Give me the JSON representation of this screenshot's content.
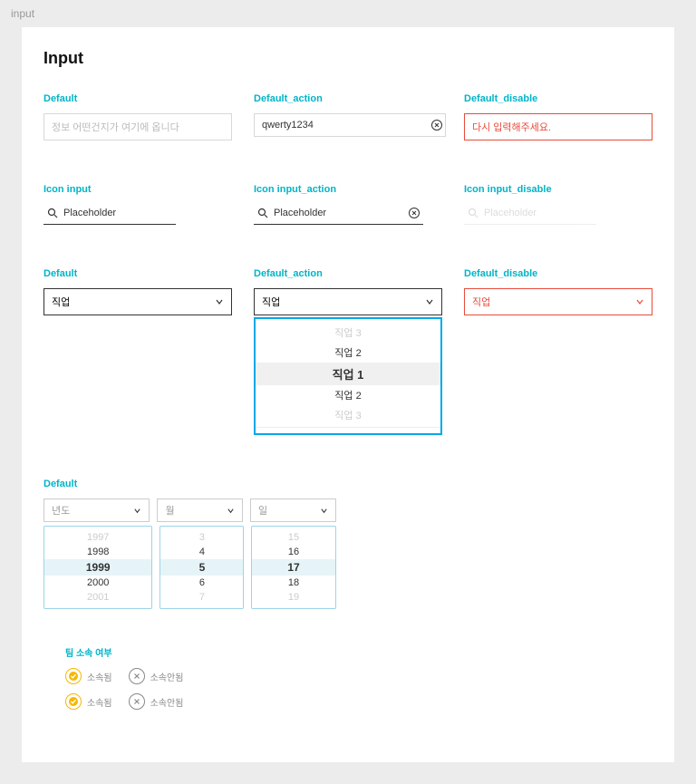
{
  "page_title": "input",
  "heading": "Input",
  "sections": {
    "default": {
      "label": "Default",
      "placeholder": "정보 어떤건지가 여기에 옵니다"
    },
    "default_action": {
      "label": "Default_action",
      "value": "qwerty1234"
    },
    "default_disable": {
      "label": "Default_disable",
      "value": "다시 입력해주세요."
    },
    "icon_input": {
      "label": "Icon input",
      "placeholder": "Placeholder"
    },
    "icon_input_action": {
      "label": "Icon input_action",
      "placeholder": "Placeholder"
    },
    "icon_input_disable": {
      "label": "Icon input_disable",
      "placeholder": "Placeholder"
    },
    "select_default": {
      "label": "Default",
      "value": "직업"
    },
    "select_action": {
      "label": "Default_action",
      "value": "직업",
      "options_muted_top": "직업 3",
      "options": [
        "직업 2",
        "직업 1",
        "직업 2"
      ],
      "options_muted_bottom": "직업 3",
      "selected_index": 1
    },
    "select_disable": {
      "label": "Default_disable",
      "value": "직업"
    },
    "date_default": {
      "label": "Default",
      "selects": [
        "년도",
        "월",
        "일"
      ],
      "year": {
        "muted_top": "1997",
        "items": [
          "1998",
          "1999",
          "2000"
        ],
        "muted_bottom": "2001",
        "selected_index": 1
      },
      "month": {
        "muted_top": "3",
        "items": [
          "4",
          "5",
          "6"
        ],
        "muted_bottom": "7",
        "selected_index": 1
      },
      "day": {
        "muted_top": "15",
        "items": [
          "16",
          "17",
          "18"
        ],
        "muted_bottom": "19",
        "selected_index": 1
      }
    },
    "radio": {
      "label": "팀 소속 여부",
      "opt1": "소속됨",
      "opt2": "소속안됨"
    }
  }
}
